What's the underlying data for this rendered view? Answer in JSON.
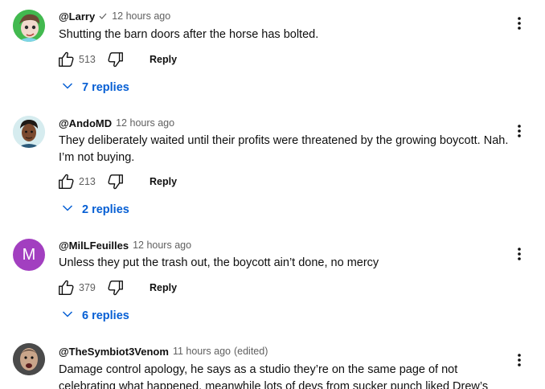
{
  "comments": [
    {
      "author": "@Larry",
      "verified_icon": "check-icon",
      "time": "12 hours ago",
      "edited": "",
      "text": "Shutting the barn doors after the horse has bolted.",
      "likes": "513",
      "reply_label": "Reply",
      "replies_label": "7 replies"
    },
    {
      "author": "@AndoMD",
      "time": "12 hours ago",
      "edited": "",
      "text": "They deliberately waited until their profits were threatened by the growing boycott. Nah. I’m not buying.",
      "likes": "213",
      "reply_label": "Reply",
      "replies_label": "2 replies"
    },
    {
      "author": "@MilLFeuilles",
      "avatar_letter": "M",
      "avatar_color": "#a23fc0",
      "time": "12 hours ago",
      "edited": "",
      "text": "Unless they put the trash out, the boycott ain’t done, no mercy",
      "likes": "379",
      "reply_label": "Reply",
      "replies_label": "6 replies"
    },
    {
      "author": "@TheSymbiot3Venom",
      "time": "11 hours ago",
      "edited": "(edited)",
      "text": "Damage control apology, he says as a studio they’re on the same page of not celebrating what happened, meanwhile lots of devs from sucker punch liked Drew’s"
    }
  ],
  "colors": {
    "link_blue": "#065fd4",
    "secondary_text": "#606060"
  }
}
